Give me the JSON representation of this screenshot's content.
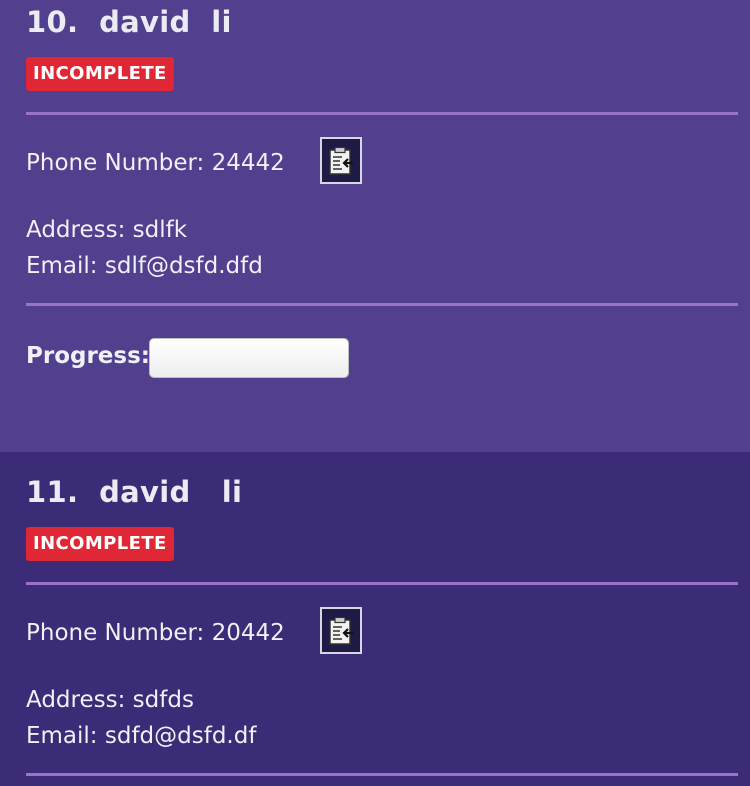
{
  "persons": [
    {
      "index": "10.",
      "name": "david  li",
      "status": "INCOMPLETE",
      "phone_label": "Phone Number:",
      "phone": "24442",
      "address_label": "Address:",
      "address": "sdlfk",
      "email_label": "Email:",
      "email": "sdlf@dsfd.dfd",
      "progress_label": "Progress:",
      "progress": 0
    },
    {
      "index": "11.",
      "name": "david   li",
      "status": "INCOMPLETE",
      "phone_label": "Phone Number:",
      "phone": "20442",
      "address_label": "Address:",
      "address": "sdfds",
      "email_label": "Email:",
      "email": "sdfd@dsfd.df"
    }
  ],
  "colors": {
    "card_1_bg": "#523f8e",
    "card_2_bg": "#3c2b76",
    "badge": "#e02735",
    "divider": "#9873c8"
  },
  "icons": {
    "copy": "clipboard-paste-icon"
  }
}
